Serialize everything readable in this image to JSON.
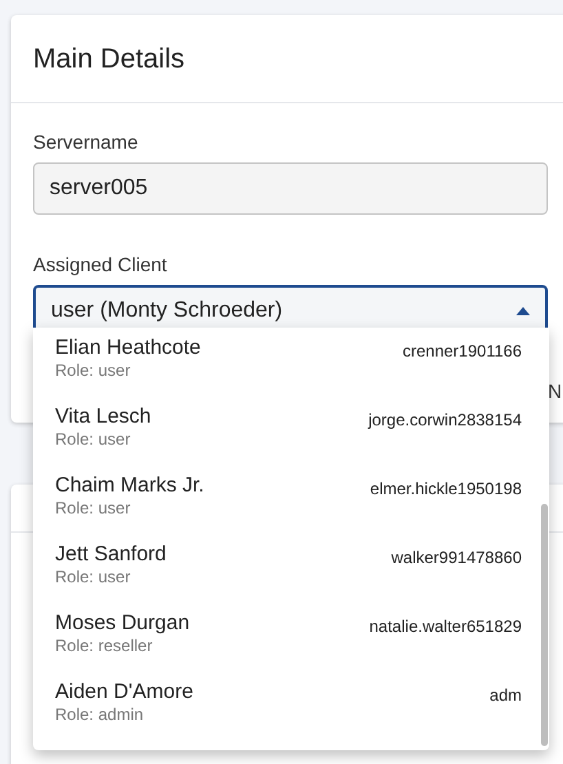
{
  "card": {
    "title": "Main Details"
  },
  "servername": {
    "label": "Servername",
    "value": "server005"
  },
  "assigned_client": {
    "label": "Assigned Client",
    "value": "user (Monty Schroeder)",
    "expanded": true
  },
  "hidden_button_text": "N",
  "options": [
    {
      "name": "Elian Heathcote",
      "role": "Role: user",
      "username": "crenner1901166"
    },
    {
      "name": "Vita Lesch",
      "role": "Role: user",
      "username": "jorge.corwin2838154"
    },
    {
      "name": "Chaim Marks Jr.",
      "role": "Role: user",
      "username": "elmer.hickle1950198"
    },
    {
      "name": "Jett Sanford",
      "role": "Role: user",
      "username": "walker991478860"
    },
    {
      "name": "Moses Durgan",
      "role": "Role: reseller",
      "username": "natalie.walter651829"
    },
    {
      "name": "Aiden D'Amore",
      "role": "Role: admin",
      "username": "adm"
    }
  ]
}
